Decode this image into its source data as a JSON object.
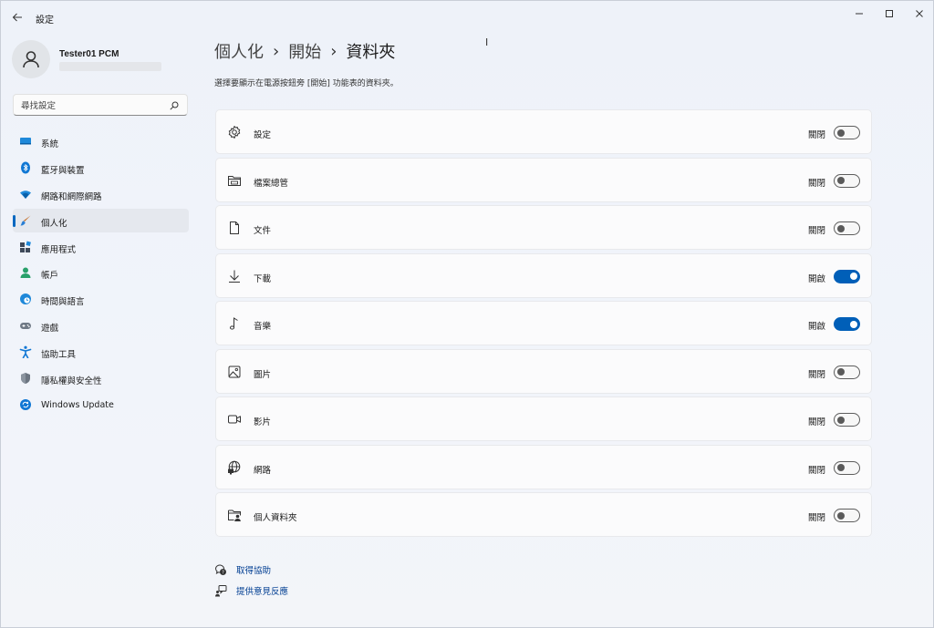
{
  "app": {
    "title": "設定"
  },
  "profile": {
    "name": "Tester01 PCM"
  },
  "search": {
    "placeholder": "尋找設定"
  },
  "sidebar": {
    "items": [
      {
        "label": "系統",
        "icon": "system-icon"
      },
      {
        "label": "藍牙與裝置",
        "icon": "bluetooth-icon"
      },
      {
        "label": "網路和網際網路",
        "icon": "wifi-icon"
      },
      {
        "label": "個人化",
        "icon": "brush-icon",
        "selected": true
      },
      {
        "label": "應用程式",
        "icon": "apps-icon"
      },
      {
        "label": "帳戶",
        "icon": "account-icon"
      },
      {
        "label": "時間與語言",
        "icon": "globe-clock-icon"
      },
      {
        "label": "遊戲",
        "icon": "gamepad-icon"
      },
      {
        "label": "協助工具",
        "icon": "accessibility-icon"
      },
      {
        "label": "隱私權與安全性",
        "icon": "shield-icon"
      },
      {
        "label": "Windows Update",
        "icon": "update-icon"
      }
    ]
  },
  "header": {
    "breadcrumb": [
      "個人化",
      "開始",
      "資料夾"
    ],
    "subtitle": "選擇要顯示在電源按鈕旁 [開始] 功能表的資料夾。",
    "cursor": "I"
  },
  "folders": [
    {
      "label": "設定",
      "icon": "gear-icon",
      "state": "關閉",
      "on": false
    },
    {
      "label": "檔案總管",
      "icon": "file-explorer-icon",
      "state": "關閉",
      "on": false
    },
    {
      "label": "文件",
      "icon": "document-icon",
      "state": "關閉",
      "on": false
    },
    {
      "label": "下載",
      "icon": "download-icon",
      "state": "開啟",
      "on": true
    },
    {
      "label": "音樂",
      "icon": "music-icon",
      "state": "開啟",
      "on": true
    },
    {
      "label": "圖片",
      "icon": "picture-icon",
      "state": "關閉",
      "on": false
    },
    {
      "label": "影片",
      "icon": "video-icon",
      "state": "關閉",
      "on": false
    },
    {
      "label": "網路",
      "icon": "network-icon",
      "state": "關閉",
      "on": false
    },
    {
      "label": "個人資料夾",
      "icon": "personal-folder-icon",
      "state": "關閉",
      "on": false
    }
  ],
  "footer_links": [
    {
      "label": "取得協助",
      "icon": "help-icon"
    },
    {
      "label": "提供意見反應",
      "icon": "feedback-icon"
    }
  ],
  "colors": {
    "accent": "#005fb8",
    "link": "#003e92",
    "selected_bg": "#e5e8ee"
  }
}
